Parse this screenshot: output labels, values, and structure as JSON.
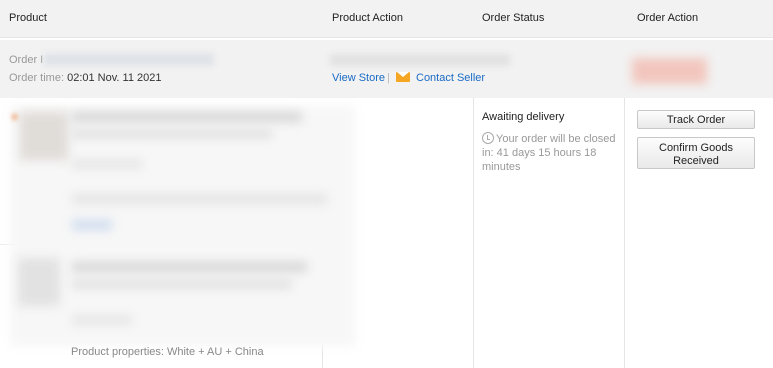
{
  "header": {
    "product": "Product",
    "product_action": "Product Action",
    "order_status": "Order Status",
    "order_action": "Order Action"
  },
  "order": {
    "number_label": "Order I",
    "time_label": "Order time:",
    "time_value": "02:01 Nov. 11 2021",
    "view_store": "View Store",
    "separator": "|",
    "contact_seller": "Contact Seller",
    "status": "Awaiting delivery",
    "closing_text": "Your order will be closed in: 41 days 15 hours 18 minutes",
    "track_button": "Track Order",
    "confirm_button": "Confirm Goods Received"
  },
  "products": [
    {
      "properties": "Product properties: White + AU + China"
    }
  ],
  "icons": {
    "mail": "mail-icon",
    "clock": "clock-icon"
  },
  "colors": {
    "link": "#1a6bc6",
    "mail_icon": "#f5a623",
    "header_bg": "#f2f2f2"
  }
}
